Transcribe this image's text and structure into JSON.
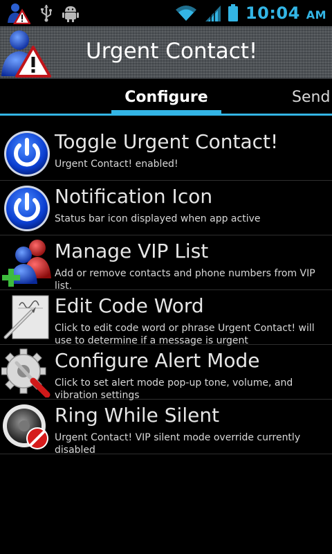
{
  "status_bar": {
    "time": "10:04",
    "ampm": "AM",
    "icons": [
      "urgent-contact-notification-icon",
      "usb-icon",
      "android-debug-icon",
      "wifi-icon",
      "signal-icon",
      "battery-icon"
    ]
  },
  "app": {
    "title": "Urgent Contact!"
  },
  "tabs": [
    {
      "label": "Configure",
      "selected": true
    },
    {
      "label": "Send",
      "selected": false
    }
  ],
  "settings": [
    {
      "title": "Toggle Urgent Contact!",
      "subtitle": "Urgent Contact! enabled!",
      "icon": "power-button-icon"
    },
    {
      "title": "Notification Icon",
      "subtitle": "Status bar icon displayed when app active",
      "icon": "power-button-icon"
    },
    {
      "title": "Manage VIP List",
      "subtitle": "Add or remove contacts and phone numbers from VIP list.",
      "icon": "vip-contacts-add-icon"
    },
    {
      "title": "Edit Code Word",
      "subtitle": "Click to edit code word or phrase Urgent Contact! will use to determine if a message is urgent",
      "icon": "signature-pen-icon"
    },
    {
      "title": "Configure Alert Mode",
      "subtitle": "Click to set alert mode pop-up tone, volume, and vibration settings",
      "icon": "gear-wrench-icon"
    },
    {
      "title": "Ring While Silent",
      "subtitle": "Urgent Contact! VIP silent mode override currently disabled",
      "icon": "speaker-muted-icon"
    }
  ],
  "colors": {
    "accent": "#33b5e5",
    "background": "#000000",
    "titlebar": "#505458"
  }
}
